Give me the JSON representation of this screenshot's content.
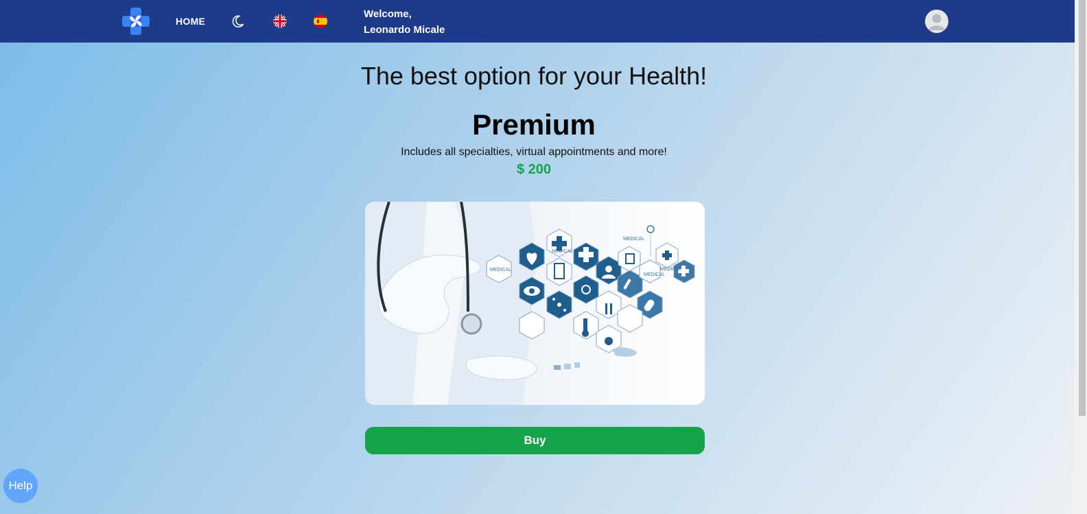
{
  "header": {
    "logo_icon": "medical-cross-logo-icon",
    "nav_home": "HOME",
    "theme_icon": "moon-icon",
    "languages": [
      {
        "code": "en",
        "icon": "uk-flag-icon"
      },
      {
        "code": "es",
        "icon": "spain-flag-icon"
      }
    ],
    "welcome_line1": "Welcome,",
    "welcome_line2": "Leonardo Micale",
    "avatar_icon": "user-avatar-icon",
    "background_color": "#1e3a8a"
  },
  "main": {
    "headline": "The best option for your Health!",
    "plan": {
      "name": "Premium",
      "description": "Includes all specialties, virtual appointments and more!",
      "price": "$ 200",
      "price_color": "#16a34a"
    },
    "image_icon": "doctor-medical-hexagons-image",
    "buy_label": "Buy",
    "buy_color": "#16a34a"
  },
  "help": {
    "label": "Help",
    "color": "#60a5fa"
  }
}
